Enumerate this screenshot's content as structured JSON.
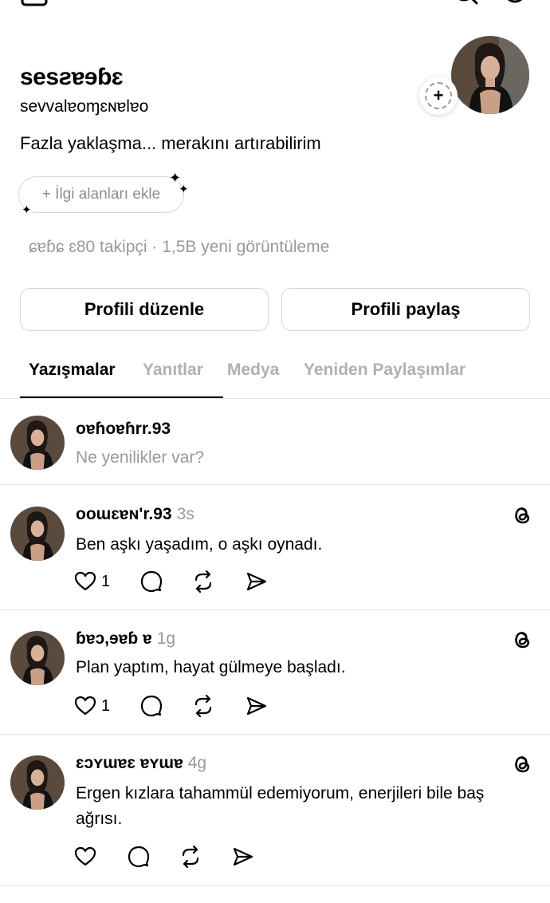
{
  "profile": {
    "name": "sesƨɐɘɓɛ",
    "handle": "sevvalɐoɱɛɴɐlɐo",
    "bio": "Fazla yaklaşma... merakını artırabilirim",
    "interests_label": "+ İlgi alanları ekle",
    "stats": "ɕɐɓɕ ɛ80 takipçi · 1,5B yeni görüntüleme"
  },
  "buttons": {
    "edit": "Profili düzenle",
    "share": "Profili paylaş"
  },
  "tabs": [
    "Yazışmalar",
    "Yanıtlar",
    "Medya",
    "Yeniden Paylaşımlar"
  ],
  "composer": {
    "username": "oɐɦoɐɦrr.93",
    "placeholder": "Ne yenilikler var?"
  },
  "posts": [
    {
      "username": "ooɯɛɐɴ'r.93",
      "time": "3s",
      "text": "Ben aşkı yaşadım, o aşkı oynadı.",
      "likes": "1"
    },
    {
      "username": "ɓɐɔ,ɘɐɓ ɐ",
      "time": "1g",
      "text": "Plan yaptım, hayat gülmeye başladı.",
      "likes": "1"
    },
    {
      "username": "ɛɔʏɯɐɛ ɐʏɯɐ",
      "time": "4g",
      "text": "Ergen kızlara tahammül edemiyorum, enerjileri bile baş ağrısı.",
      "likes": ""
    }
  ],
  "colors": {
    "muted": "#999999",
    "border": "#d9d9d9",
    "text": "#000000"
  }
}
